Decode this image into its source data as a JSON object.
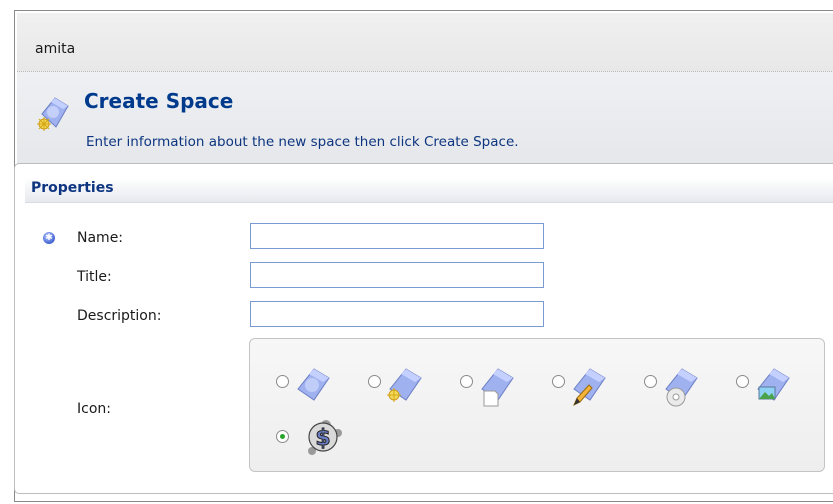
{
  "breadcrumb": {
    "user": "amita"
  },
  "header": {
    "title": "Create Space",
    "subtitle": "Enter information about the new space then click Create Space."
  },
  "properties": {
    "section_title": "Properties",
    "fields": {
      "name": {
        "label": "Name:",
        "value": "",
        "required": true
      },
      "title": {
        "label": "Title:",
        "value": ""
      },
      "description": {
        "label": "Description:",
        "value": ""
      }
    },
    "icon": {
      "label": "Icon:",
      "options": [
        {
          "name": "space-icon-default",
          "selected": false
        },
        {
          "name": "space-icon-star",
          "selected": false
        },
        {
          "name": "space-icon-document",
          "selected": false
        },
        {
          "name": "space-icon-pencil",
          "selected": false
        },
        {
          "name": "space-icon-cd",
          "selected": false
        },
        {
          "name": "space-icon-image",
          "selected": false
        },
        {
          "name": "space-icon-dollar",
          "selected": true
        }
      ]
    }
  },
  "colors": {
    "title_blue": "#003a8c",
    "label_blue": "#0d3580",
    "field_border": "#7a9bd2",
    "selected_radio": "#2aa52a"
  }
}
